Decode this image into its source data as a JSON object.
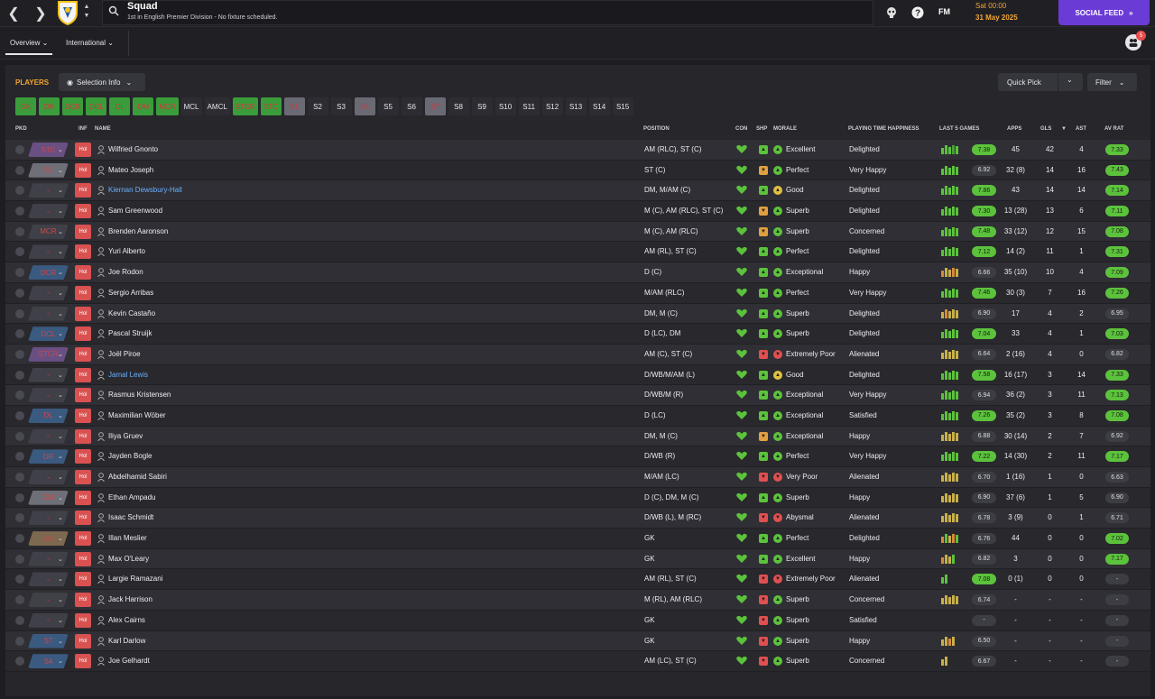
{
  "header": {
    "page_title": "Squad",
    "subtitle": "1st in English Premier Division - No fixture scheduled.",
    "fm_logo": "FM",
    "date_day": "Sat 00:00",
    "date_full": "31 May 2025",
    "social_feed": "SOCIAL FEED",
    "notification_count": "5"
  },
  "subnav": {
    "overview": "Overview",
    "international": "International"
  },
  "toolbar": {
    "players_label": "PLAYERS",
    "selection_info": "Selection Info",
    "quick_pick": "Quick Pick",
    "filter": "Filter"
  },
  "chips": [
    {
      "label": "GK",
      "style": "green"
    },
    {
      "label": "DR",
      "style": "green"
    },
    {
      "label": "DCR",
      "style": "green"
    },
    {
      "label": "DCL",
      "style": "green"
    },
    {
      "label": "DL",
      "style": "green"
    },
    {
      "label": "DM",
      "style": "green"
    },
    {
      "label": "MCR",
      "style": "green"
    },
    {
      "label": "MCL",
      "style": "dark"
    },
    {
      "label": "AMCL",
      "style": "dark"
    },
    {
      "label": "STCR",
      "style": "green"
    },
    {
      "label": "STC",
      "style": "green"
    },
    {
      "label": "S1",
      "style": "gray"
    },
    {
      "label": "S2",
      "style": "dark"
    },
    {
      "label": "S3",
      "style": "dark"
    },
    {
      "label": "S4",
      "style": "gray"
    },
    {
      "label": "S5",
      "style": "dark"
    },
    {
      "label": "S6",
      "style": "dark"
    },
    {
      "label": "S7",
      "style": "gray"
    },
    {
      "label": "S8",
      "style": "dark"
    },
    {
      "label": "S9",
      "style": "dark"
    },
    {
      "label": "S10",
      "style": "dark"
    },
    {
      "label": "S11",
      "style": "dark"
    },
    {
      "label": "S12",
      "style": "dark"
    },
    {
      "label": "S13",
      "style": "dark"
    },
    {
      "label": "S14",
      "style": "dark"
    },
    {
      "label": "S15",
      "style": "dark"
    }
  ],
  "columns": {
    "pkd": "PKD",
    "inf": "INF",
    "name": "NAME",
    "position": "POSITION",
    "con": "CON",
    "shp": "SHP",
    "morale": "MORALE",
    "happiness": "PLAYING TIME HAPPINESS",
    "last5": "LAST 5 GAMES",
    "apps": "APPS",
    "gls": "GLS",
    "ast": "AST",
    "avrat": "AV RAT"
  },
  "colors": {
    "accent": "#f2a534",
    "social": "#6b3bd6",
    "good": "#5cc23c",
    "inf": "#d95151"
  },
  "players": [
    {
      "pos": "STC",
      "tag": "purple",
      "inf": "Hol",
      "name": "Wilfried Gnonto",
      "link": false,
      "position": "AM (RLC), ST (C)",
      "shp": "up",
      "morale_icon": "up",
      "morale": "Excellent",
      "happiness": "Delighted",
      "last5": "gggbg",
      "l5": "7.38",
      "l5g": true,
      "apps": "45",
      "gls": "42",
      "ast": "4",
      "avr": "7.33",
      "avg": true
    },
    {
      "pos": "S1",
      "tag": "gray",
      "inf": "Hol",
      "name": "Mateo Joseph",
      "link": false,
      "position": "ST (C)",
      "shp": "mid",
      "morale_icon": "up",
      "morale": "Perfect",
      "happiness": "Very Happy",
      "last5": "ggggg",
      "l5": "6.92",
      "l5g": false,
      "apps": "32 (8)",
      "gls": "14",
      "ast": "16",
      "avr": "7.43",
      "avg": true
    },
    {
      "pos": "-",
      "tag": "none",
      "inf": "Hol",
      "name": "Kiernan Dewsbury-Hall",
      "link": true,
      "position": "DM, M/AM (C)",
      "shp": "up",
      "morale_icon": "mid",
      "morale": "Good",
      "happiness": "Delighted",
      "last5": "ggggg",
      "l5": "7.86",
      "l5g": true,
      "apps": "43",
      "gls": "14",
      "ast": "14",
      "avr": "7.14",
      "avg": true
    },
    {
      "pos": "-",
      "tag": "none",
      "inf": "Hol",
      "name": "Sam Greenwood",
      "link": false,
      "position": "M (C), AM (RLC), ST (C)",
      "shp": "mid",
      "morale_icon": "up",
      "morale": "Superb",
      "happiness": "Delighted",
      "last5": "ggggg",
      "l5": "7.30",
      "l5g": true,
      "apps": "13 (28)",
      "gls": "13",
      "ast": "6",
      "avr": "7.11",
      "avg": true
    },
    {
      "pos": "MCR",
      "tag": "none",
      "inf": "Hol",
      "name": "Brenden Aaronson",
      "link": false,
      "position": "M (C), AM (RLC)",
      "shp": "mid",
      "morale_icon": "up",
      "morale": "Superb",
      "happiness": "Concerned",
      "last5": "ggggg",
      "l5": "7.48",
      "l5g": true,
      "apps": "33 (12)",
      "gls": "12",
      "ast": "15",
      "avr": "7.08",
      "avg": true
    },
    {
      "pos": "-",
      "tag": "none",
      "inf": "Hol",
      "name": "Yuri Alberto",
      "link": false,
      "position": "AM (RL), ST (C)",
      "shp": "up",
      "morale_icon": "up",
      "morale": "Perfect",
      "happiness": "Delighted",
      "last5": "ggggg",
      "l5": "7.12",
      "l5g": true,
      "apps": "14 (2)",
      "gls": "11",
      "ast": "1",
      "avr": "7.31",
      "avg": true
    },
    {
      "pos": "DCR",
      "tag": "blue",
      "inf": "Hol",
      "name": "Joe Rodon",
      "link": false,
      "position": "D (C)",
      "shp": "up",
      "morale_icon": "up",
      "morale": "Exceptional",
      "happiness": "Happy",
      "last5": "oyyoy",
      "l5": "6.66",
      "l5g": false,
      "apps": "35 (10)",
      "gls": "10",
      "ast": "4",
      "avr": "7.09",
      "avg": true
    },
    {
      "pos": "-",
      "tag": "none",
      "inf": "Hol",
      "name": "Sergio Arribas",
      "link": false,
      "position": "M/AM (RLC)",
      "shp": "up",
      "morale_icon": "up",
      "morale": "Perfect",
      "happiness": "Very Happy",
      "last5": "ggggg",
      "l5": "7.46",
      "l5g": true,
      "apps": "30 (3)",
      "gls": "7",
      "ast": "16",
      "avr": "7.26",
      "avg": true
    },
    {
      "pos": "-",
      "tag": "none",
      "inf": "Hol",
      "name": "Kevin Castaño",
      "link": false,
      "position": "DM, M (C)",
      "shp": "up",
      "morale_icon": "up",
      "morale": "Superb",
      "happiness": "Delighted",
      "last5": "yoyyy",
      "l5": "6.90",
      "l5g": false,
      "apps": "17",
      "gls": "4",
      "ast": "2",
      "avr": "6.95",
      "avg": false
    },
    {
      "pos": "DCL",
      "tag": "blue",
      "inf": "Hol",
      "name": "Pascal Struijk",
      "link": false,
      "position": "D (LC), DM",
      "shp": "up",
      "morale_icon": "up",
      "morale": "Superb",
      "happiness": "Delighted",
      "last5": "ggggg",
      "l5": "7.04",
      "l5g": true,
      "apps": "33",
      "gls": "4",
      "ast": "1",
      "avr": "7.03",
      "avg": true
    },
    {
      "pos": "STCR",
      "tag": "purple",
      "inf": "Hol",
      "name": "Joël Piroe",
      "link": false,
      "position": "AM (C), ST (C)",
      "shp": "down",
      "morale_icon": "down",
      "morale": "Extremely Poor",
      "happiness": "Alienated",
      "last5": "yyyyy",
      "l5": "6.64",
      "l5g": false,
      "apps": "2 (16)",
      "gls": "4",
      "ast": "0",
      "avr": "6.82",
      "avg": false
    },
    {
      "pos": "-",
      "tag": "none",
      "inf": "Hol",
      "name": "Jamal Lewis",
      "link": true,
      "position": "D/WB/M/AM (L)",
      "shp": "up",
      "morale_icon": "mid",
      "morale": "Good",
      "happiness": "Delighted",
      "last5": "ggggg",
      "l5": "7.58",
      "l5g": true,
      "apps": "16 (17)",
      "gls": "3",
      "ast": "14",
      "avr": "7.33",
      "avg": true
    },
    {
      "pos": "-",
      "tag": "none",
      "inf": "Hol",
      "name": "Rasmus Kristensen",
      "link": false,
      "position": "D/WB/M (R)",
      "shp": "up",
      "morale_icon": "up",
      "morale": "Exceptional",
      "happiness": "Very Happy",
      "last5": "ggggg",
      "l5": "6.94",
      "l5g": false,
      "apps": "36 (2)",
      "gls": "3",
      "ast": "11",
      "avr": "7.13",
      "avg": true
    },
    {
      "pos": "DL",
      "tag": "blue",
      "inf": "Hol",
      "name": "Maximilian Wöber",
      "link": false,
      "position": "D (LC)",
      "shp": "up",
      "morale_icon": "up",
      "morale": "Exceptional",
      "happiness": "Satisfied",
      "last5": "ggggg",
      "l5": "7.26",
      "l5g": true,
      "apps": "35 (2)",
      "gls": "3",
      "ast": "8",
      "avr": "7.08",
      "avg": true
    },
    {
      "pos": "-",
      "tag": "none",
      "inf": "Hol",
      "name": "Iliya Gruev",
      "link": false,
      "position": "DM, M (C)",
      "shp": "mid",
      "morale_icon": "up",
      "morale": "Exceptional",
      "happiness": "Happy",
      "last5": "yyyyy",
      "l5": "6.88",
      "l5g": false,
      "apps": "30 (14)",
      "gls": "2",
      "ast": "7",
      "avr": "6.92",
      "avg": false
    },
    {
      "pos": "DR",
      "tag": "blue",
      "inf": "Hol",
      "name": "Jayden Bogle",
      "link": false,
      "position": "D/WB (R)",
      "shp": "up",
      "morale_icon": "up",
      "morale": "Perfect",
      "happiness": "Very Happy",
      "last5": "ggggg",
      "l5": "7.22",
      "l5g": true,
      "apps": "14 (30)",
      "gls": "2",
      "ast": "11",
      "avr": "7.17",
      "avg": true
    },
    {
      "pos": "-",
      "tag": "none",
      "inf": "Hol",
      "name": "Abdelhamid Sabiri",
      "link": false,
      "position": "M/AM (LC)",
      "shp": "down",
      "morale_icon": "down",
      "morale": "Very Poor",
      "happiness": "Alienated",
      "last5": "yyyyy",
      "l5": "6.70",
      "l5g": false,
      "apps": "1 (16)",
      "gls": "1",
      "ast": "0",
      "avr": "6.63",
      "avg": false
    },
    {
      "pos": "DM",
      "tag": "gray",
      "inf": "Hol",
      "name": "Ethan Ampadu",
      "link": false,
      "position": "D (C), DM, M (C)",
      "shp": "up",
      "morale_icon": "up",
      "morale": "Superb",
      "happiness": "Happy",
      "last5": "yyyyy",
      "l5": "6.90",
      "l5g": false,
      "apps": "37 (6)",
      "gls": "1",
      "ast": "5",
      "avr": "6.90",
      "avg": false
    },
    {
      "pos": "-",
      "tag": "none",
      "inf": "Hol",
      "name": "Isaac Schmidt",
      "link": false,
      "position": "D/WB (L), M (RC)",
      "shp": "down",
      "morale_icon": "down",
      "morale": "Abysmal",
      "happiness": "Alienated",
      "last5": "yyyyy",
      "l5": "6.78",
      "l5g": false,
      "apps": "3 (9)",
      "gls": "0",
      "ast": "1",
      "avr": "6.71",
      "avg": false
    },
    {
      "pos": "GK",
      "tag": "brown",
      "inf": "Hol",
      "name": "Illan Meslier",
      "link": false,
      "position": "GK",
      "shp": "up",
      "morale_icon": "up",
      "morale": "Perfect",
      "happiness": "Delighted",
      "last5": "ogyog",
      "l5": "6.76",
      "l5g": false,
      "apps": "44",
      "gls": "0",
      "ast": "0",
      "avr": "7.02",
      "avg": true
    },
    {
      "pos": "-",
      "tag": "none",
      "inf": "Hol",
      "name": "Max O'Leary",
      "link": false,
      "position": "GK",
      "shp": "up",
      "morale_icon": "up",
      "morale": "Excellent",
      "happiness": "Happy",
      "last5": "oyyg",
      "l5": "6.82",
      "l5g": false,
      "apps": "3",
      "gls": "0",
      "ast": "0",
      "avr": "7.17",
      "avg": true
    },
    {
      "pos": "-",
      "tag": "none",
      "inf": "Hol",
      "name": "Largie Ramazani",
      "link": false,
      "position": "AM (RL), ST (C)",
      "shp": "down",
      "morale_icon": "down",
      "morale": "Extremely Poor",
      "happiness": "Alienated",
      "last5": "gg",
      "l5": "7.08",
      "l5g": true,
      "apps": "0 (1)",
      "gls": "0",
      "ast": "0",
      "avr": "-",
      "avg": false
    },
    {
      "pos": "-",
      "tag": "none",
      "inf": "Hol",
      "name": "Jack Harrison",
      "link": false,
      "position": "M (RL), AM (RLC)",
      "shp": "down",
      "morale_icon": "up",
      "morale": "Superb",
      "happiness": "Concerned",
      "last5": "yyyyy",
      "l5": "6.74",
      "l5g": false,
      "apps": "-",
      "gls": "-",
      "ast": "-",
      "avr": "-",
      "avg": false
    },
    {
      "pos": "-",
      "tag": "none",
      "inf": "Hol",
      "name": "Alex Cairns",
      "link": false,
      "position": "GK",
      "shp": "down",
      "morale_icon": "up",
      "morale": "Superb",
      "happiness": "Satisfied",
      "last5": "",
      "l5": "-",
      "l5g": false,
      "apps": "-",
      "gls": "-",
      "ast": "-",
      "avr": "-",
      "avg": false
    },
    {
      "pos": "S7",
      "tag": "blue",
      "inf": "Hol",
      "name": "Karl Darlow",
      "link": false,
      "position": "GK",
      "shp": "down",
      "morale_icon": "up",
      "morale": "Superb",
      "happiness": "Happy",
      "last5": "yyoy",
      "l5": "6.50",
      "l5g": false,
      "apps": "-",
      "gls": "-",
      "ast": "-",
      "avr": "-",
      "avg": false
    },
    {
      "pos": "S4",
      "tag": "blue",
      "inf": "Hol",
      "name": "Joe Gelhardt",
      "link": false,
      "position": "AM (LC), ST (C)",
      "shp": "down",
      "morale_icon": "up",
      "morale": "Superb",
      "happiness": "Concerned",
      "last5": "yy",
      "l5": "6.67",
      "l5g": false,
      "apps": "-",
      "gls": "-",
      "ast": "-",
      "avr": "-",
      "avg": false
    }
  ]
}
